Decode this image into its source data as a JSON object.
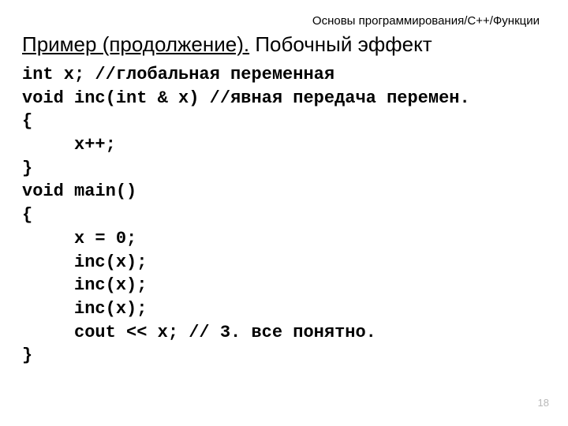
{
  "header": {
    "path": "Основы программирования/C++/Функции"
  },
  "title": {
    "underlined": "Пример (продолжение).",
    "rest": " Побочный эффект"
  },
  "code": {
    "line1": "int x; //глобальная переменная",
    "line2": "void inc(int & x) //явная передача перемен.",
    "line3": "{",
    "line4": "     x++;",
    "line5": "}",
    "line6": "void main()",
    "line7": "{",
    "line8": "     x = 0;",
    "line9": "     inc(x);",
    "line10": "     inc(x);",
    "line11": "     inc(x);",
    "line12": "     cout << x; // 3. все понятно.",
    "line13": "}"
  },
  "page_number": "18"
}
